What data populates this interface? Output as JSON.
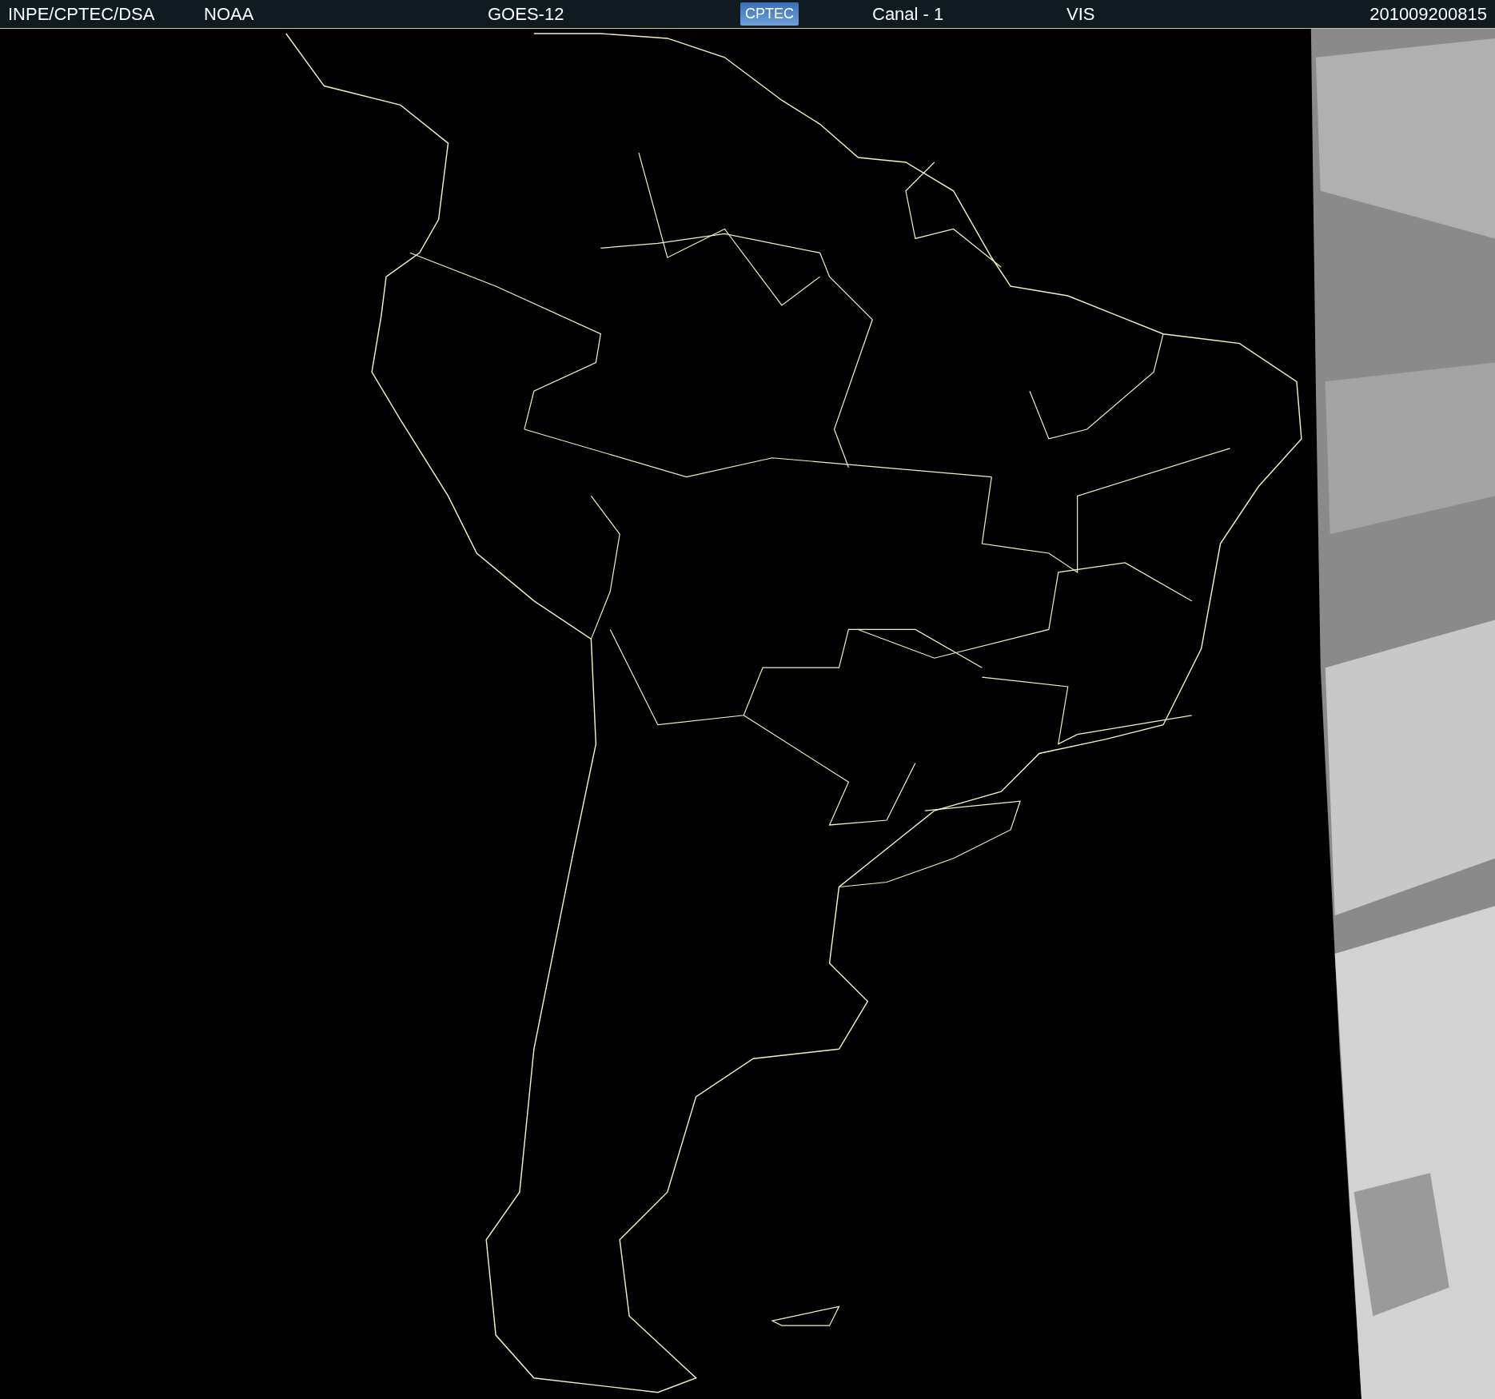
{
  "header": {
    "source": "INPE/CPTEC/DSA",
    "agency": "NOAA",
    "satellite": "GOES-12",
    "logo": "CPTEC",
    "channel": "Canal - 1",
    "band": "VIS",
    "timestamp": "201009200815"
  }
}
